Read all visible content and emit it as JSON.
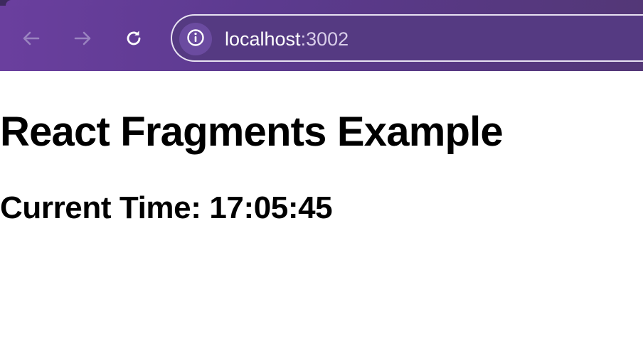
{
  "browser": {
    "url_host": "localhost",
    "url_port": ":3002",
    "icons": {
      "back": "arrow-left-icon",
      "forward": "arrow-right-icon",
      "reload": "reload-icon",
      "site_info": "info-icon"
    },
    "colors": {
      "toolbar": "#5c3a8f",
      "address_bar_border": "#e8e2f2"
    }
  },
  "page": {
    "title": "React Fragments Example",
    "time_label": "Current Time:",
    "time_value": "17:05:45"
  }
}
